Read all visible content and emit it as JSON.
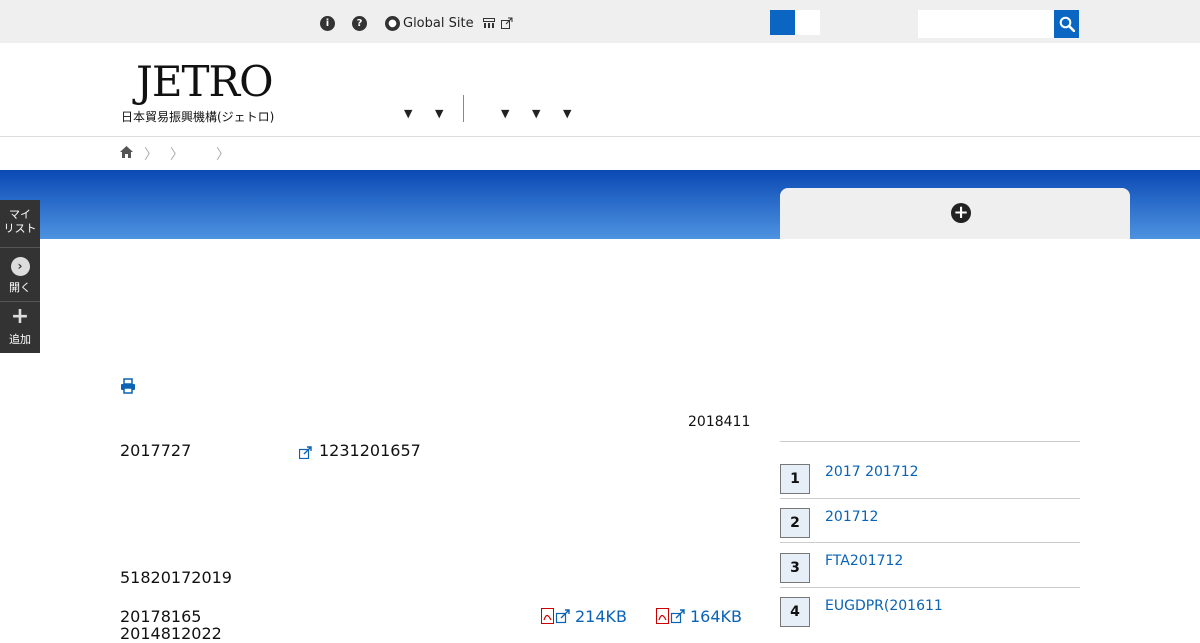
{
  "topbar": {
    "global_site_label": "Global Site"
  },
  "header": {
    "logo_text": "JETRO",
    "logo_subtitle": "日本貿易振興機構(ジェトロ)"
  },
  "mylist": {
    "title": "マイ\nリスト",
    "open_label": "開く",
    "add_label": "追加"
  },
  "article": {
    "date": "2018411",
    "line1_left": "2017727",
    "line1_right": "1231201657",
    "line2": "51820172019",
    "line3": "20178165",
    "line4": "2014812022"
  },
  "attachments": [
    {
      "size": "214KB"
    },
    {
      "size": "164KB"
    }
  ],
  "ranking": [
    {
      "rank": "1",
      "title": "2017 201712"
    },
    {
      "rank": "2",
      "title": "201712"
    },
    {
      "rank": "3",
      "title": "FTA201712"
    },
    {
      "rank": "4",
      "title": "EUGDPR(201611"
    }
  ],
  "colors": {
    "brand_blue": "#0a66c2",
    "link_blue": "#0a63b4",
    "topbar_bg": "#efefef"
  }
}
